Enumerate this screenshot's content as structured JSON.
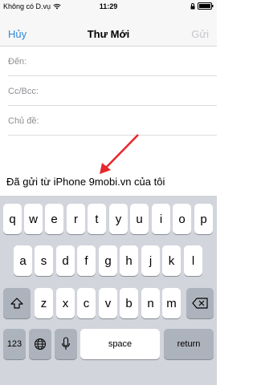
{
  "status": {
    "carrier": "Không có D.vụ",
    "time": "11:29"
  },
  "nav": {
    "cancel": "Hủy",
    "title": "Thư Mới",
    "send": "Gửi"
  },
  "fields": {
    "to": "Đến:",
    "cc": "Cc/Bcc:",
    "subject": "Chủ đề:"
  },
  "body": {
    "signature": "Đã gửi từ iPhone 9mobi.vn của tôi"
  },
  "keyboard": {
    "row1": [
      "q",
      "w",
      "e",
      "r",
      "t",
      "y",
      "u",
      "i",
      "o",
      "p"
    ],
    "row2": [
      "a",
      "s",
      "d",
      "f",
      "g",
      "h",
      "j",
      "k",
      "l"
    ],
    "row3": [
      "z",
      "x",
      "c",
      "v",
      "b",
      "n",
      "m"
    ],
    "numbers": "123",
    "space": "space",
    "return": "return"
  },
  "colors": {
    "accent": "#2f86d8",
    "annotation_arrow": "#e8262b"
  }
}
